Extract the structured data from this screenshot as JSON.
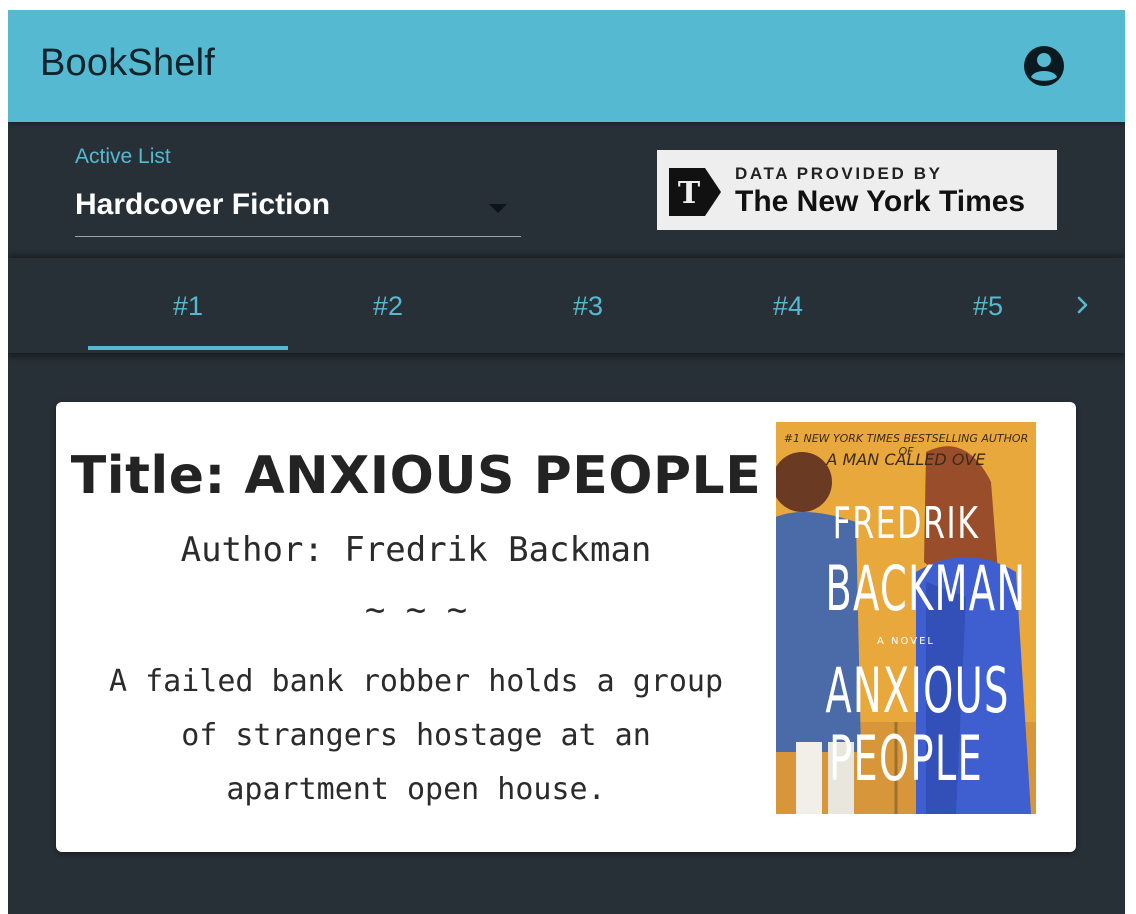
{
  "app": {
    "title": "BookShelf",
    "account_icon": "account-circle-icon"
  },
  "active_list": {
    "label": "Active List",
    "selected": "Hardcover Fiction"
  },
  "attribution": {
    "small": "DATA PROVIDED BY",
    "big": "The New York Times",
    "logo_letter": "T"
  },
  "tabs": [
    {
      "label": "#1",
      "selected": true
    },
    {
      "label": "#2",
      "selected": false
    },
    {
      "label": "#3",
      "selected": false
    },
    {
      "label": "#4",
      "selected": false
    },
    {
      "label": "#5",
      "selected": false
    }
  ],
  "next_icon": "chevron-right-icon",
  "book": {
    "title": "Title: ANXIOUS PEOPLE",
    "author": "Author: Fredrik Backman",
    "divider": "~ ~ ~",
    "description": "A failed bank robber holds a group of strangers hostage at an apartment open house.",
    "cover": {
      "line1": "#1 NEW YORK TIMES BESTSELLING AUTHOR OF",
      "line2": "A MAN CALLED OVE",
      "author_first": "FREDRIK",
      "author_last": "BACKMAN",
      "novel": "A NOVEL",
      "title1": "ANXIOUS",
      "title2": "PEOPLE"
    }
  },
  "colors": {
    "appbar": "#54b9d1",
    "background": "#283037",
    "accent": "#54b9d1",
    "card": "#ffffff",
    "cover_bg": "#e8a83c"
  }
}
